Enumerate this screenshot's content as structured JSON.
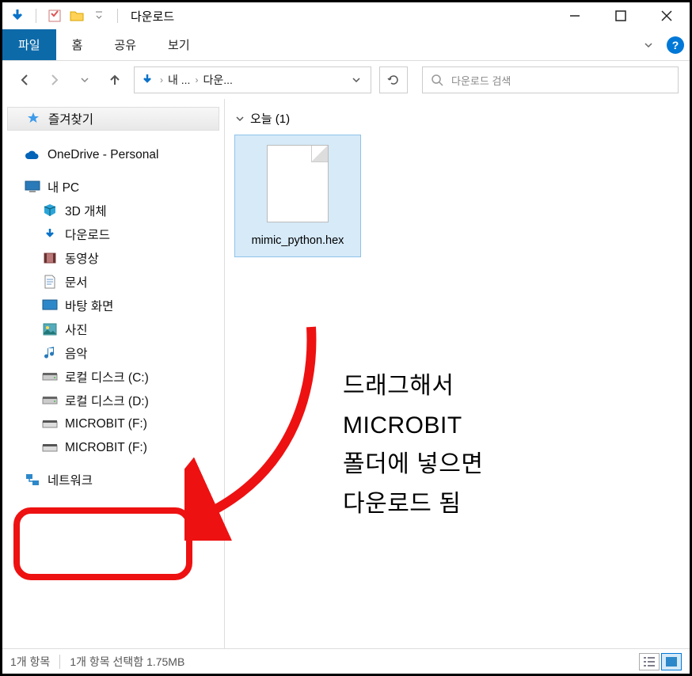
{
  "titlebar": {
    "title": "다운로드"
  },
  "ribbon": {
    "file": "파일",
    "home": "홈",
    "share": "공유",
    "view": "보기"
  },
  "address": {
    "seg1": "내 ...",
    "seg2": "다운..."
  },
  "search": {
    "placeholder": "다운로드 검색"
  },
  "tree": {
    "quick_access": "즐겨찾기",
    "onedrive": "OneDrive - Personal",
    "this_pc": "내 PC",
    "objects3d": "3D 개체",
    "downloads": "다운로드",
    "videos": "동영상",
    "documents": "문서",
    "desktop": "바탕 화면",
    "pictures": "사진",
    "music": "음악",
    "disk_c": "로컬 디스크 (C:)",
    "disk_d": "로컬 디스크 (D:)",
    "microbit_f_1": "MICROBIT (F:)",
    "microbit_f_2": "MICROBIT (F:)",
    "network": "네트워크"
  },
  "content": {
    "group_label": "오늘 (1)",
    "file_name": "mimic_python.hex"
  },
  "annotation": {
    "line1": "드래그해서",
    "line2": "MICROBIT",
    "line3": "폴더에 넣으면",
    "line4": "다운로드 됨"
  },
  "status": {
    "count": "1개 항목",
    "selection": "1개 항목 선택함 1.75MB"
  }
}
